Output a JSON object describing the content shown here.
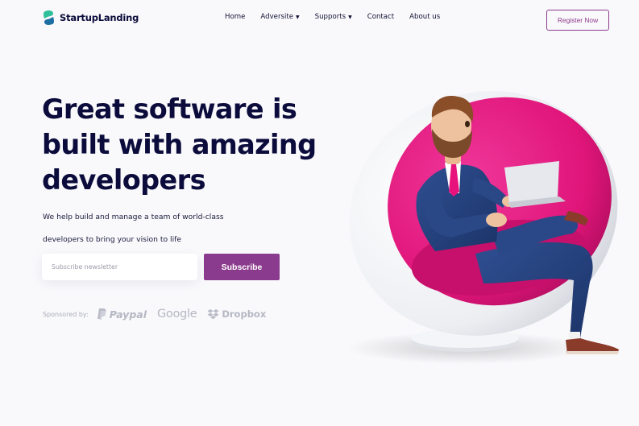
{
  "brand": {
    "name": "StartupLanding",
    "accent": "#8b3b8d"
  },
  "nav": {
    "items": [
      {
        "label": "Home",
        "has_dropdown": false
      },
      {
        "label": "Adversite",
        "has_dropdown": true
      },
      {
        "label": "Supports",
        "has_dropdown": true
      },
      {
        "label": "Contact",
        "has_dropdown": false
      },
      {
        "label": "About us",
        "has_dropdown": false
      }
    ],
    "cta_label": "Register Now"
  },
  "hero": {
    "title_lines": [
      "Great software is",
      "built with amazing",
      "developers"
    ],
    "description_lines": [
      "We help build and manage a team of world-class",
      "developers to bring your vision to life"
    ],
    "subscribe": {
      "placeholder": "Subscribe newsletter",
      "button_label": "Subscribe"
    }
  },
  "sponsors": {
    "label": "Sponsored by:",
    "items": [
      {
        "name": "Paypal",
        "icon": "paypal-icon"
      },
      {
        "name": "Google",
        "icon": ""
      },
      {
        "name": "Dropbox",
        "icon": "dropbox-icon"
      }
    ]
  },
  "colors": {
    "title": "#0c0c3c",
    "chair_pink": "#e8127c",
    "chair_shell": "#f1f1f4",
    "suit": "#25427d"
  }
}
